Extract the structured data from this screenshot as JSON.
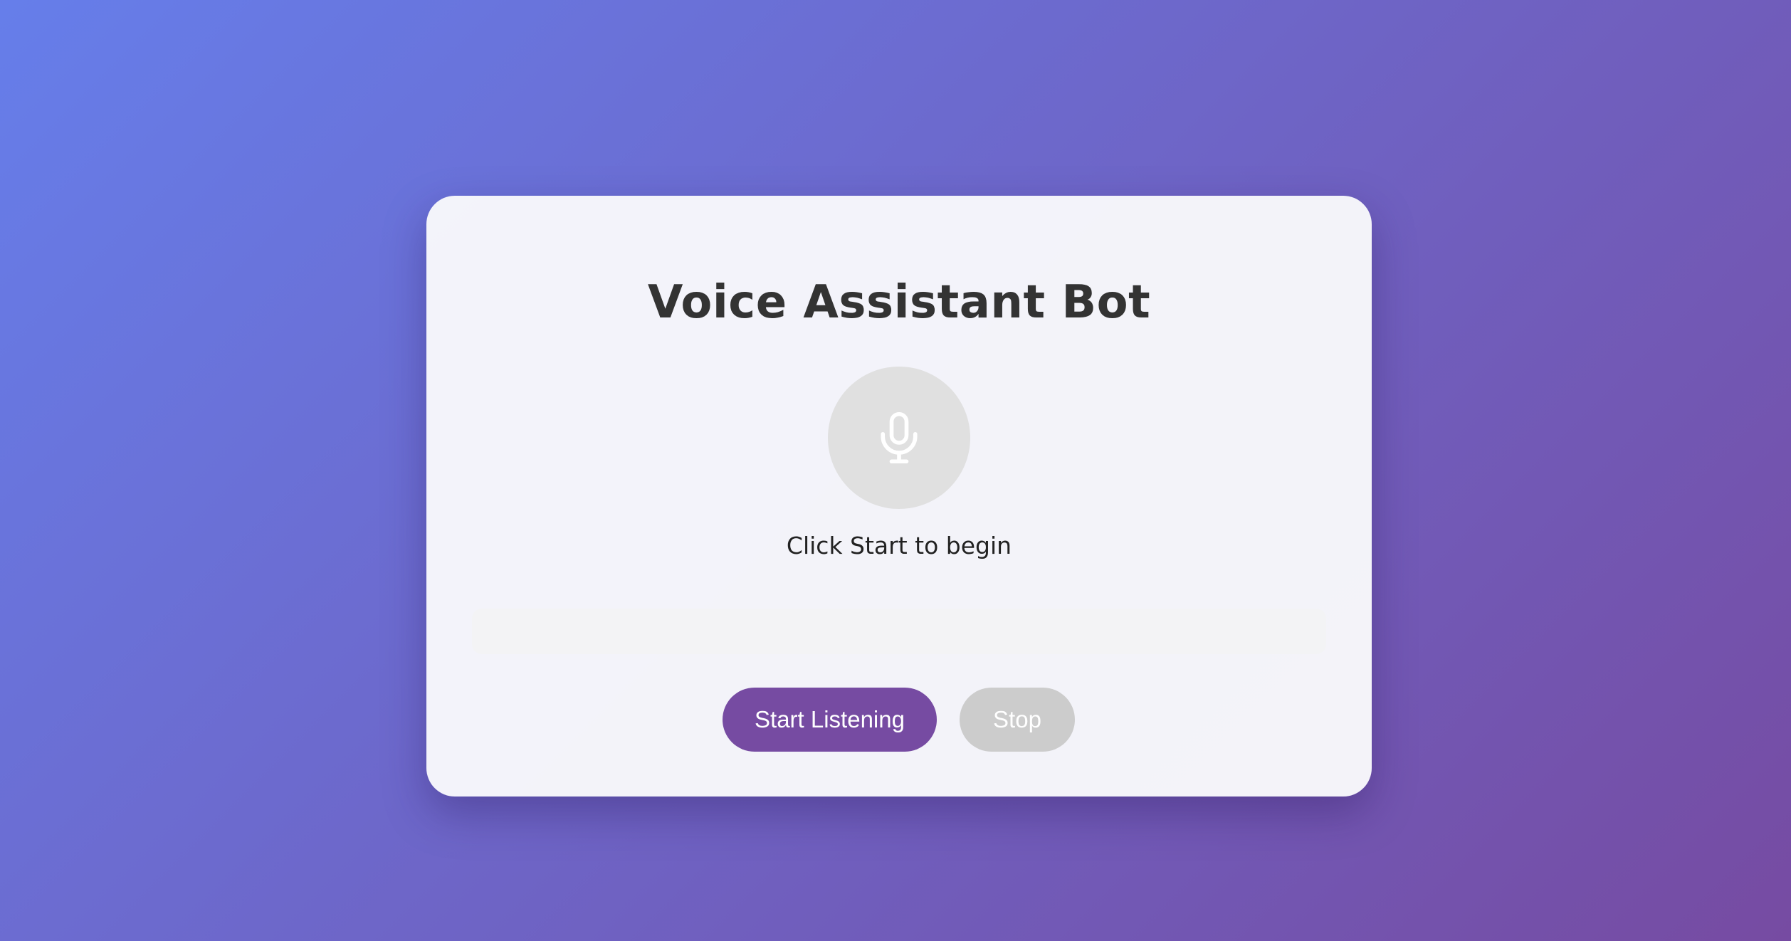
{
  "app": {
    "title": "Voice Assistant Bot"
  },
  "status": {
    "text": "Click Start to begin"
  },
  "transcript": {
    "text": ""
  },
  "controls": {
    "start_label": "Start Listening",
    "stop_label": "Stop",
    "stop_disabled": true
  },
  "icons": {
    "mic": "microphone-icon"
  },
  "colors": {
    "gradient_start": "#667eea",
    "gradient_end": "#764ba2",
    "primary": "#764ba2",
    "disabled": "#cccccc",
    "mic_background": "#e0e0e0",
    "title": "#333333"
  }
}
